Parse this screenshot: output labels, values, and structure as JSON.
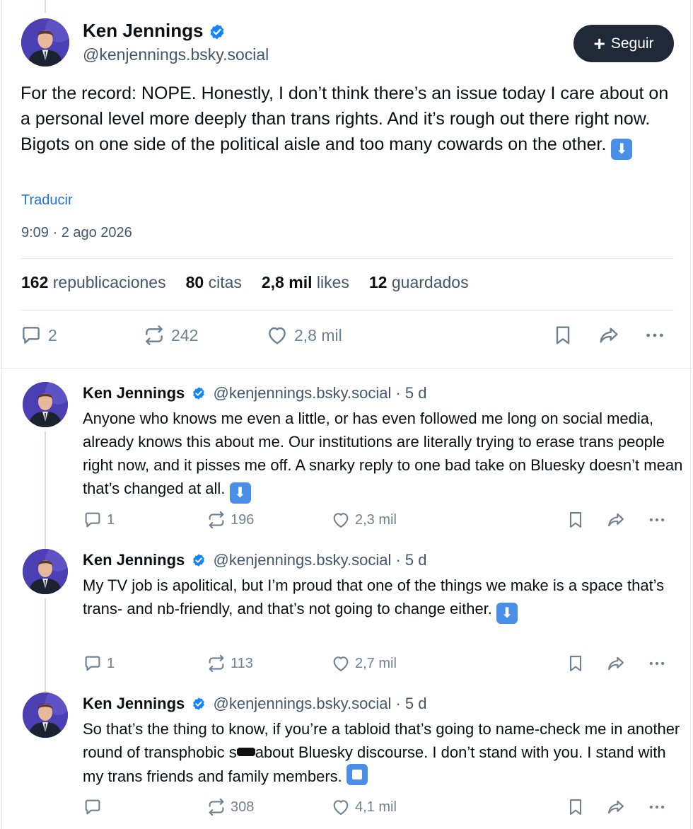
{
  "main_post": {
    "author_name": "Ken Jennings",
    "author_handle": "@kenjennings.bsky.social",
    "follow_label": "Seguir",
    "text": "For the record: NOPE. Honestly, I don’t think there’s an issue today I care about on a personal level more deeply than trans rights. And it’s rough out there right now. Bigots on one side of the political aisle and too many cowards on the other.",
    "emoji": "⬇",
    "translate_label": "Traducir",
    "timestamp": "9:09 · 2 ago 2026",
    "stats": [
      {
        "count": "162",
        "label": "republicaciones"
      },
      {
        "count": "80",
        "label": "citas"
      },
      {
        "count": "2,8 mil",
        "label": "likes"
      },
      {
        "count": "12",
        "label": "guardados"
      }
    ],
    "actions": {
      "replies": "2",
      "reposts": "242",
      "likes": "2,8 mil"
    }
  },
  "replies": [
    {
      "author_name": "Ken Jennings",
      "meta": "@kenjennings.bsky.social · 5 d",
      "text": "Anyone who knows me even a little, or has even followed me long on social media, already knows this about me. Our institutions are literally trying to erase trans people right now, and it pisses me off. A snarky reply to one bad take on Bluesky doesn’t mean that’s changed at all.",
      "emoji": "⬇",
      "replies": "1",
      "reposts": "196",
      "likes": "2,3 mil"
    },
    {
      "author_name": "Ken Jennings",
      "meta": "@kenjennings.bsky.social · 5 d",
      "text": "My TV job is apolitical, but I’m proud that one of the things we make is a space that’s trans- and nb-friendly, and that’s not going to change either.",
      "emoji": "⬇",
      "replies": "1",
      "reposts": "113",
      "likes": "2,7 mil"
    },
    {
      "author_name": "Ken Jennings",
      "meta": "@kenjennings.bsky.social · 5 d",
      "text_part1": "So that’s the thing to know, if you’re a tabloid that’s going to name-check me in another round of transphobic s",
      "text_part2": "about Bluesky discourse. I don’t stand with you. I stand with my trans friends and family members.",
      "replies": "",
      "reposts": "308",
      "likes": "4,1 mil"
    }
  ],
  "colors": {
    "accent": "#1a73e8",
    "verified": "#1185fe",
    "follow_bg": "#1f2937",
    "muted": "#42576c"
  }
}
